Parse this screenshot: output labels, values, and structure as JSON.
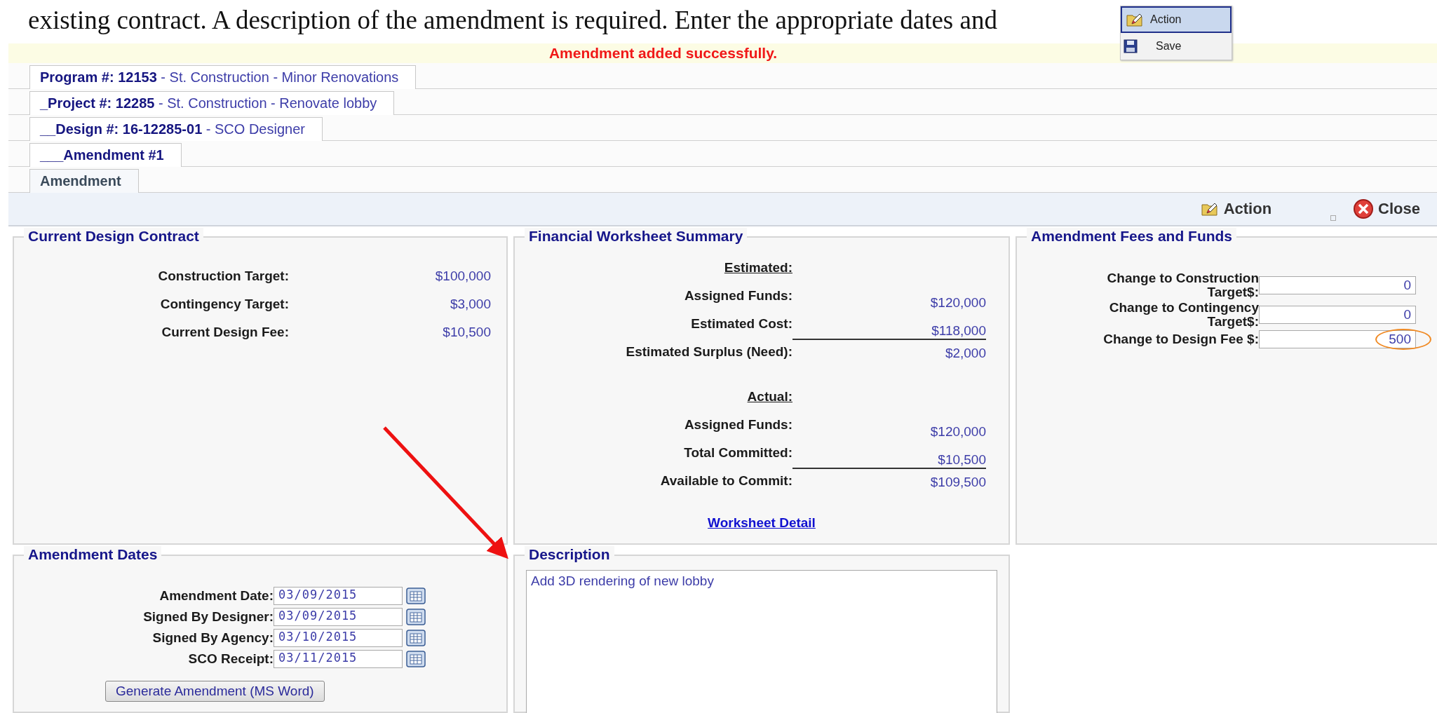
{
  "intro_text": "existing contract. A description of the amendment is required. Enter the appropriate dates and",
  "inset_menu": {
    "items": [
      {
        "label": "Action",
        "kind": "action",
        "selected": true
      },
      {
        "label": "Save",
        "kind": "save",
        "selected": false
      }
    ]
  },
  "banner": "Amendment added successfully.",
  "tabs": [
    {
      "code": "Program #: 12153",
      "name": "- St. Construction - Minor Renovations",
      "selected": false
    },
    {
      "code": "_Project #: 12285",
      "name": "- St. Construction - Renovate lobby",
      "selected": false
    },
    {
      "code": "__Design #: 16-12285-01",
      "name": "- SCO Designer",
      "selected": false
    },
    {
      "code": "___Amendment #1",
      "selected": false
    },
    {
      "code": "Amendment",
      "selected": true
    }
  ],
  "toolbar": {
    "buttons": [
      {
        "label": "Action",
        "kind": "action"
      },
      {
        "label": "Close",
        "kind": "close"
      }
    ]
  },
  "current_design_contract": {
    "title": "Current Design Contract",
    "rows": [
      {
        "label": "Construction Target:",
        "value": "$100,000"
      },
      {
        "label": "Contingency Target:",
        "value": "$3,000"
      },
      {
        "label": "Current Design Fee:",
        "value": "$10,500"
      }
    ]
  },
  "financial_summary": {
    "title": "Financial Worksheet Summary",
    "sections": [
      {
        "heading": "Estimated:",
        "rows": [
          {
            "label": "Assigned Funds:",
            "value": "$120,000",
            "total": false
          },
          {
            "label": "Estimated Cost:",
            "value": "$118,000",
            "total": false
          },
          {
            "label": "Estimated Surplus (Need):",
            "value": "$2,000",
            "total": true
          }
        ]
      },
      {
        "heading": "Actual:",
        "rows": [
          {
            "label": "Assigned Funds:",
            "value": "$120,000",
            "total": false
          },
          {
            "label": "Total Committed:",
            "value": "$10,500",
            "total": false
          },
          {
            "label": "Available to Commit:",
            "value": "$109,500",
            "total": true
          }
        ]
      }
    ],
    "link": "Worksheet Detail"
  },
  "amendment_fees": {
    "title": "Amendment Fees and Funds",
    "fields": [
      {
        "label": "Change to Construction Target$:",
        "value": "0",
        "highlighted": false
      },
      {
        "label": "Change to Contingency Target$:",
        "value": "0",
        "highlighted": false
      },
      {
        "label": "Change to Design Fee $:",
        "value": "500",
        "highlighted": true
      }
    ]
  },
  "amendment_dates": {
    "title": "Amendment Dates",
    "fields": [
      {
        "label": "Amendment Date:",
        "value": "03/09/2015"
      },
      {
        "label": "Signed By Designer:",
        "value": "03/09/2015"
      },
      {
        "label": "Signed By Agency:",
        "value": "03/10/2015"
      },
      {
        "label": "SCO Receipt:",
        "value": "03/11/2015"
      }
    ],
    "button": "Generate Amendment (MS Word)"
  },
  "description": {
    "title": "Description",
    "value": "Add 3D rendering of new lobby"
  }
}
